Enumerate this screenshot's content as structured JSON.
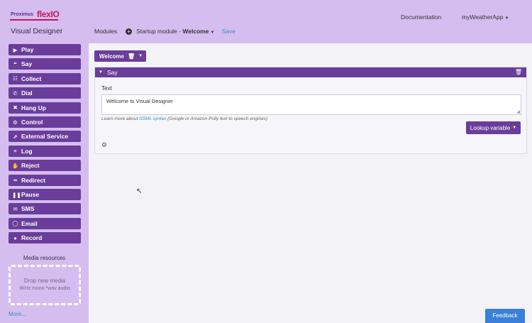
{
  "header": {
    "logo_small": "Proximus",
    "logo_big": "flexIO",
    "app_title": "Visual Designer",
    "docs_link": "Documentation",
    "app_menu": "myWeatherApp"
  },
  "breadcrumb": {
    "modules": "Modules",
    "module_prefix": "Startup module - ",
    "module_name": "Welcome",
    "save": "Save"
  },
  "sidebar": {
    "items": [
      {
        "label": "Play",
        "icon": "play-icon",
        "glyph": "▶"
      },
      {
        "label": "Say",
        "icon": "quote-icon",
        "glyph": "❝"
      },
      {
        "label": "Collect",
        "icon": "grid-icon",
        "glyph": "☷"
      },
      {
        "label": "Dial",
        "icon": "phone-icon",
        "glyph": "✆"
      },
      {
        "label": "Hang Up",
        "icon": "hangup-icon",
        "glyph": "✖"
      },
      {
        "label": "Control",
        "icon": "gears-icon",
        "glyph": "⚙"
      },
      {
        "label": "External Service",
        "icon": "external-link-icon",
        "glyph": "⇗"
      },
      {
        "label": "Log",
        "icon": "list-icon",
        "glyph": "≡"
      },
      {
        "label": "Reject",
        "icon": "thumbs-down-icon",
        "glyph": "✋"
      },
      {
        "label": "Redirect",
        "icon": "link-icon",
        "glyph": "∞"
      },
      {
        "label": "Pause",
        "icon": "pause-icon",
        "glyph": "❚❚"
      },
      {
        "label": "SMS",
        "icon": "envelope-icon",
        "glyph": "✉"
      },
      {
        "label": "Email",
        "icon": "comment-icon",
        "glyph": "◯"
      },
      {
        "label": "Record",
        "icon": "microphone-icon",
        "glyph": "●"
      }
    ],
    "media_title": "Media resources",
    "drop_title": "Drop new media",
    "drop_sub": "8kHz mono *wav audio",
    "more": "More..."
  },
  "main": {
    "module_tab": "Welcome",
    "panel_title": "Say",
    "field_label": "Text",
    "text_value": "Welcome to Visual Designer",
    "help_prefix": "Learn more about ",
    "help_link": "SSML syntax",
    "help_suffix": " (Google or Amazon Polly text to speech engines)",
    "lookup_button": "Lookup variable"
  },
  "feedback": "Feedback",
  "colors": {
    "header_bg": "#d5bdf0",
    "accent_purple": "#6a3d9a",
    "link_blue": "#3b8fc4",
    "feedback_blue": "#3a7fd8"
  }
}
